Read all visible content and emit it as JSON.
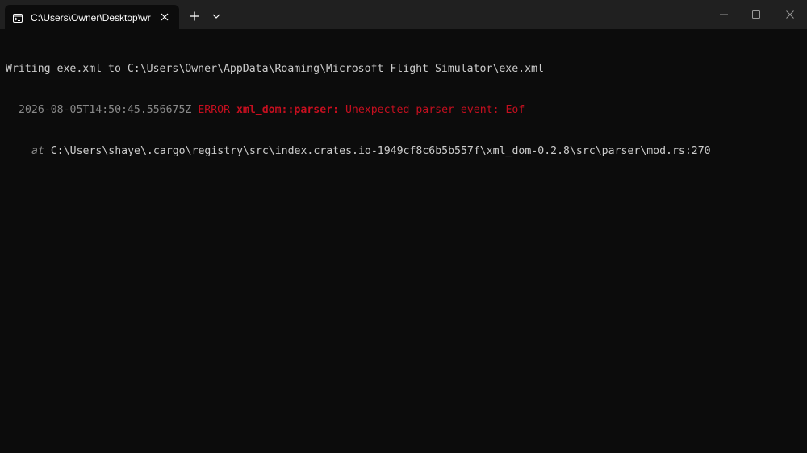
{
  "titlebar": {
    "tab_title": "C:\\Users\\Owner\\Desktop\\wr",
    "icons": {
      "tab": "terminal-icon",
      "close_tab": "close-icon",
      "new_tab": "plus-icon",
      "dropdown": "chevron-down-icon",
      "minimize": "minimize-icon",
      "maximize": "maximize-icon",
      "close_window": "close-icon"
    }
  },
  "terminal": {
    "line1": "Writing exe.xml to C:\\Users\\Owner\\AppData\\Roaming\\Microsoft Flight Simulator\\exe.xml",
    "line2": {
      "timestamp": "2026-08-05T14:50:45.556675Z",
      "level": "ERROR",
      "target": "xml_dom::parser:",
      "message": "Unexpected parser event: Eof"
    },
    "line3": {
      "prefix": "at",
      "location": "C:\\Users\\shaye\\.cargo\\registry\\src\\index.crates.io-1949cf8c6b5b557f\\xml_dom-0.2.8\\src\\parser\\mod.rs:270"
    }
  },
  "colors": {
    "background": "#0c0c0c",
    "titlebar": "#202020",
    "text": "#cccccc",
    "dim": "#8a8a8a",
    "error": "#c50f1f"
  }
}
